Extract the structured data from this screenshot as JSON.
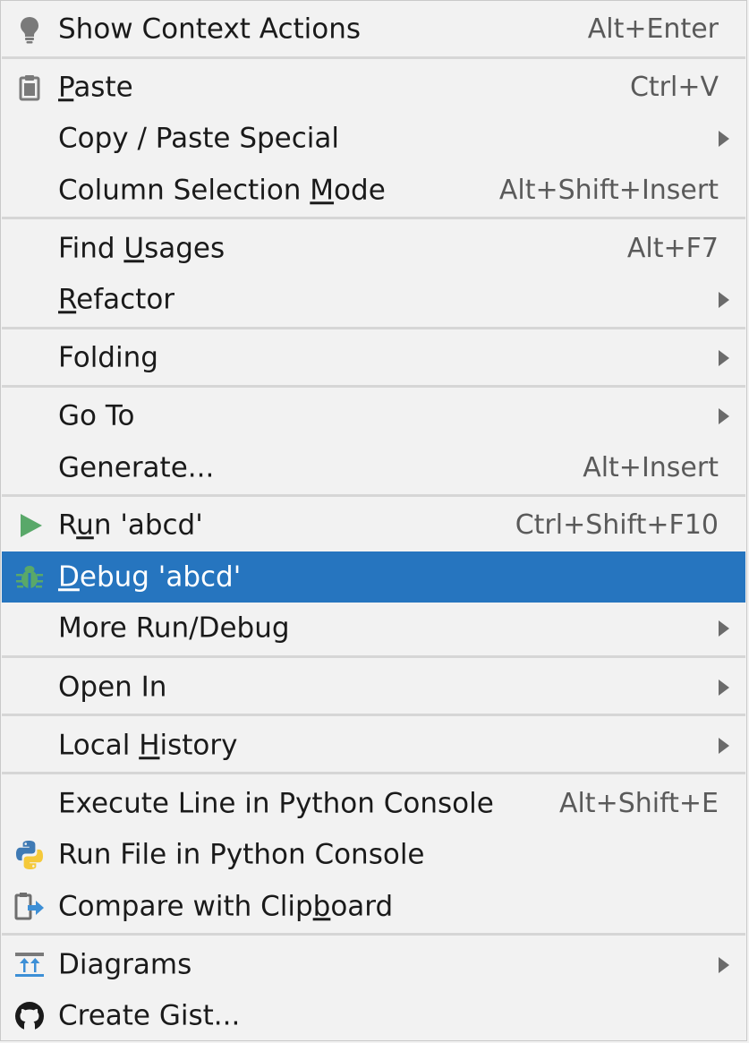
{
  "menu": {
    "items": [
      {
        "label": "Show Context Actions",
        "shortcut": "Alt+Enter",
        "icon": "lightbulb-icon"
      },
      {
        "label_pre": "",
        "label_u": "P",
        "label_post": "aste",
        "shortcut": "Ctrl+V",
        "icon": "clipboard-icon"
      },
      {
        "label": "Copy / Paste Special",
        "submenu": true
      },
      {
        "label_pre": "Column Selection ",
        "label_u": "M",
        "label_post": "ode",
        "shortcut": "Alt+Shift+Insert"
      },
      {
        "label_pre": "Find ",
        "label_u": "U",
        "label_post": "sages",
        "shortcut": "Alt+F7"
      },
      {
        "label_pre": "",
        "label_u": "R",
        "label_post": "efactor",
        "submenu": true
      },
      {
        "label": "Folding",
        "submenu": true
      },
      {
        "label": "Go To",
        "submenu": true
      },
      {
        "label": "Generate...",
        "shortcut": "Alt+Insert"
      },
      {
        "label_pre": "R",
        "label_u": "u",
        "label_post": "n 'abcd'",
        "shortcut": "Ctrl+Shift+F10",
        "icon": "run-icon"
      },
      {
        "label_pre": "",
        "label_u": "D",
        "label_post": "ebug 'abcd'",
        "icon": "debug-bug-icon",
        "selected": true
      },
      {
        "label": "More Run/Debug",
        "submenu": true
      },
      {
        "label": "Open In",
        "submenu": true
      },
      {
        "label_pre": "Local ",
        "label_u": "H",
        "label_post": "istory",
        "submenu": true
      },
      {
        "label": "Execute Line in Python Console",
        "shortcut": "Alt+Shift+E"
      },
      {
        "label": "Run File in Python Console",
        "icon": "python-icon"
      },
      {
        "label_pre": "Compare with Clip",
        "label_u": "b",
        "label_post": "oard",
        "icon": "compare-clipboard-icon"
      },
      {
        "label": "Diagrams",
        "submenu": true,
        "icon": "diagram-icon"
      },
      {
        "label": "Create Gist...",
        "icon": "github-icon"
      }
    ]
  },
  "colors": {
    "background": "#f2f2f2",
    "selection": "#2675bf",
    "run_green": "#59a869",
    "separator": "#d6d6d6"
  }
}
